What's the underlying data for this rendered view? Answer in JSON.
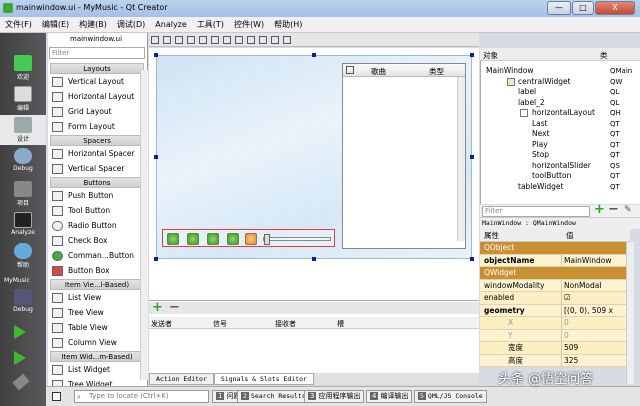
{
  "window": {
    "title": "mainwindow.ui - MyMusic - Qt Creator",
    "min": "—",
    "max": "□",
    "close": "X"
  },
  "menu": [
    "文件(F)",
    "编辑(E)",
    "构建(B)",
    "调试(D)",
    "Analyze",
    "工具(T)",
    "控件(W)",
    "帮助(H)"
  ],
  "modes": [
    {
      "label": "欢迎",
      "icon": "qt-logo-icon"
    },
    {
      "label": "编辑",
      "icon": "edit-icon"
    },
    {
      "label": "设计",
      "icon": "design-icon"
    },
    {
      "label": "Debug",
      "icon": "debug-icon"
    },
    {
      "label": "项目",
      "icon": "project-icon"
    },
    {
      "label": "Analyze",
      "icon": "analyze-icon"
    },
    {
      "label": "帮助",
      "icon": "help-icon"
    }
  ],
  "kit": {
    "project": "MyMusic",
    "config": "Debug"
  },
  "editor_tab": "mainwindow.ui",
  "widgetbox": {
    "filter_placeholder": "Filter",
    "cats": {
      "layouts": "Layouts",
      "spacers": "Spacers",
      "buttons": "Buttons",
      "itemview": "Item Vie...l-Based)",
      "itemwidget": "Item Wid...m-Based)"
    },
    "layouts": [
      "Vertical Layout",
      "Horizontal Layout",
      "Grid Layout",
      "Form Layout"
    ],
    "spacers": [
      "Horizontal Spacer",
      "Vertical Spacer"
    ],
    "buttons": [
      "Push Button",
      "Tool Button",
      "Radio Button",
      "Check Box",
      "Comman...Button",
      "Button Box"
    ],
    "itemview": [
      "List View",
      "Tree View",
      "Table View",
      "Column View"
    ],
    "itemwidget": [
      "List Widget",
      "Tree Widget"
    ]
  },
  "table_headers": [
    "歌曲",
    "类型"
  ],
  "signal_headers": [
    "发送者",
    "信号",
    "接收者",
    "槽"
  ],
  "signal_tabs": [
    "Action Editor",
    "Signals & Slots Editor"
  ],
  "object": {
    "headers": [
      "对象",
      "类"
    ],
    "rows": [
      {
        "name": "MainWindow",
        "cls": "QMain"
      },
      {
        "name": "centralWidget",
        "cls": "QW"
      },
      {
        "name": "label",
        "cls": "QL"
      },
      {
        "name": "label_2",
        "cls": "QL"
      },
      {
        "name": "horizontalLayout",
        "cls": "QH"
      },
      {
        "name": "Last",
        "cls": "QT"
      },
      {
        "name": "Next",
        "cls": "QT"
      },
      {
        "name": "Play",
        "cls": "QT"
      },
      {
        "name": "Stop",
        "cls": "QT"
      },
      {
        "name": "horizontalSlider",
        "cls": "QS"
      },
      {
        "name": "toolButton",
        "cls": "QT"
      },
      {
        "name": "tableWidget",
        "cls": "QT"
      }
    ]
  },
  "props": {
    "filter_placeholder": "Filter",
    "class_line": "MainWindow : QMainWindow",
    "headers": [
      "属性",
      "值"
    ],
    "rows": [
      {
        "n": "QObject",
        "v": "",
        "t": "grp"
      },
      {
        "n": "objectName",
        "v": "MainWindow",
        "t": "bold"
      },
      {
        "n": "QWidget",
        "v": "",
        "t": "grp"
      },
      {
        "n": "windowModality",
        "v": "NonModal",
        "t": "y"
      },
      {
        "n": "enabled",
        "v": "☑",
        "t": "y2"
      },
      {
        "n": "geometry",
        "v": "[(0, 0), 509 x 3...",
        "t": "bold"
      },
      {
        "n": "X",
        "v": "0",
        "t": "sub"
      },
      {
        "n": "Y",
        "v": "0",
        "t": "sub"
      },
      {
        "n": "宽度",
        "v": "509",
        "t": "sub2"
      },
      {
        "n": "高度",
        "v": "325",
        "t": "sub2"
      }
    ]
  },
  "status": {
    "locate_placeholder": "Type to locate (Ctrl+K)",
    "tabs": [
      {
        "n": "1",
        "l": "问题"
      },
      {
        "n": "2",
        "l": "Search Results"
      },
      {
        "n": "3",
        "l": "应用程序输出"
      },
      {
        "n": "4",
        "l": "编译输出"
      },
      {
        "n": "5",
        "l": "QML/JS Console"
      }
    ]
  },
  "watermark": "头条 @悟空问答"
}
